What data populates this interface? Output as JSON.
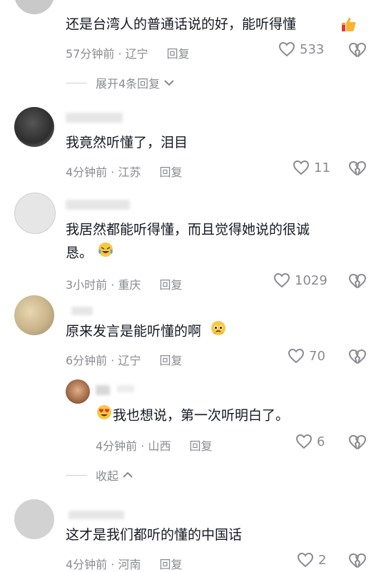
{
  "comments": [
    {
      "text": "还是台湾人的普通话说的好，能听得懂",
      "time": "57分钟前 · 辽宁",
      "reply": "回复",
      "likes": "533"
    },
    {
      "text": "我竟然听懂了，泪目",
      "time": "4分钟前 · 江苏",
      "reply": "回复",
      "likes": "11"
    },
    {
      "text_line1": "我居然都能听得懂，而且觉得她说的很诚",
      "text_line2": "恳。",
      "time": "3小时前 · 重庆",
      "reply": "回复",
      "likes": "1029"
    },
    {
      "text": "原来发言是能听懂的啊",
      "time": "6分钟前 · 辽宁",
      "reply": "回复",
      "likes": "70"
    },
    {
      "text": "这才是我们都听的懂的中国话",
      "time": "4分钟前 · 河南",
      "reply": "回复",
      "likes": "2"
    }
  ],
  "sub_reply": {
    "text": "我也想说，第一次听明白了。",
    "time": "4分钟前 · 山西",
    "reply": "回复",
    "likes": "6"
  },
  "expand_label": "展开4条回复",
  "collapse_label": "收起",
  "colors": {
    "text": "#161823",
    "meta": "#8a8b91",
    "heart_outline": "#8a8b91"
  }
}
